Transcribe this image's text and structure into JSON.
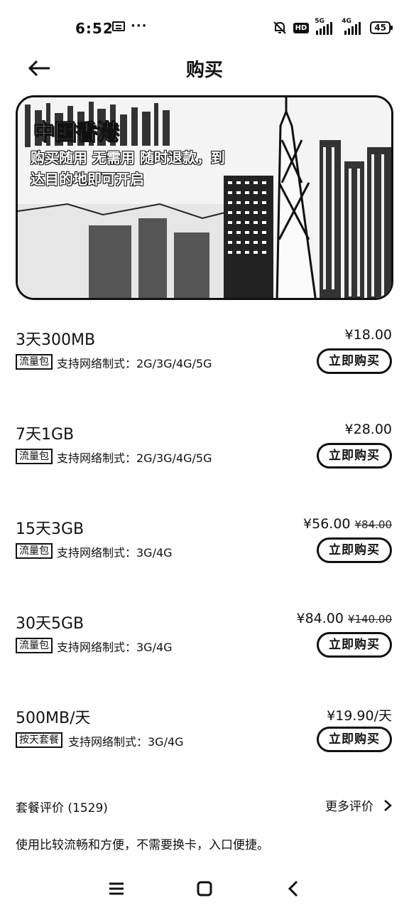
{
  "status_bar": {
    "time": "6:52",
    "hd": "HD",
    "net1": "5G",
    "net2": "4G",
    "battery": "45"
  },
  "header": {
    "title": "购买"
  },
  "banner": {
    "title": "中国香港",
    "subtitle": "购买随用  无需用  随时退款，到达目的地即可开启"
  },
  "plans": [
    {
      "name": "3天300MB",
      "price": "¥18.00",
      "original_price": "",
      "tag": "流量包",
      "support": "支持网络制式：2G/3G/4G/5G",
      "button": "立即购买"
    },
    {
      "name": "7天1GB",
      "price": "¥28.00",
      "original_price": "",
      "tag": "流量包",
      "support": "支持网络制式：2G/3G/4G/5G",
      "button": "立即购买"
    },
    {
      "name": "15天3GB",
      "price": "¥56.00",
      "original_price": "¥84.00",
      "tag": "流量包",
      "support": "支持网络制式：3G/4G",
      "button": "立即购买"
    },
    {
      "name": "30天5GB",
      "price": "¥84.00",
      "original_price": "¥140.00",
      "tag": "流量包",
      "support": "支持网络制式：3G/4G",
      "button": "立即购买"
    },
    {
      "name": "500MB/天",
      "price": "¥19.90/天",
      "original_price": "",
      "tag": "按天套餐",
      "support": "支持网络制式：3G/4G",
      "button": "立即购买"
    }
  ],
  "reviews": {
    "header": "套餐评价 (1529)",
    "more": "更多评价",
    "first_review": "使用比较流畅和方便，不需要换卡，入口便捷。"
  },
  "icons": {
    "back": "arrow-left-icon",
    "more": "chevron-right-icon",
    "nav": [
      "menu-icon",
      "home-icon",
      "back-icon"
    ]
  }
}
